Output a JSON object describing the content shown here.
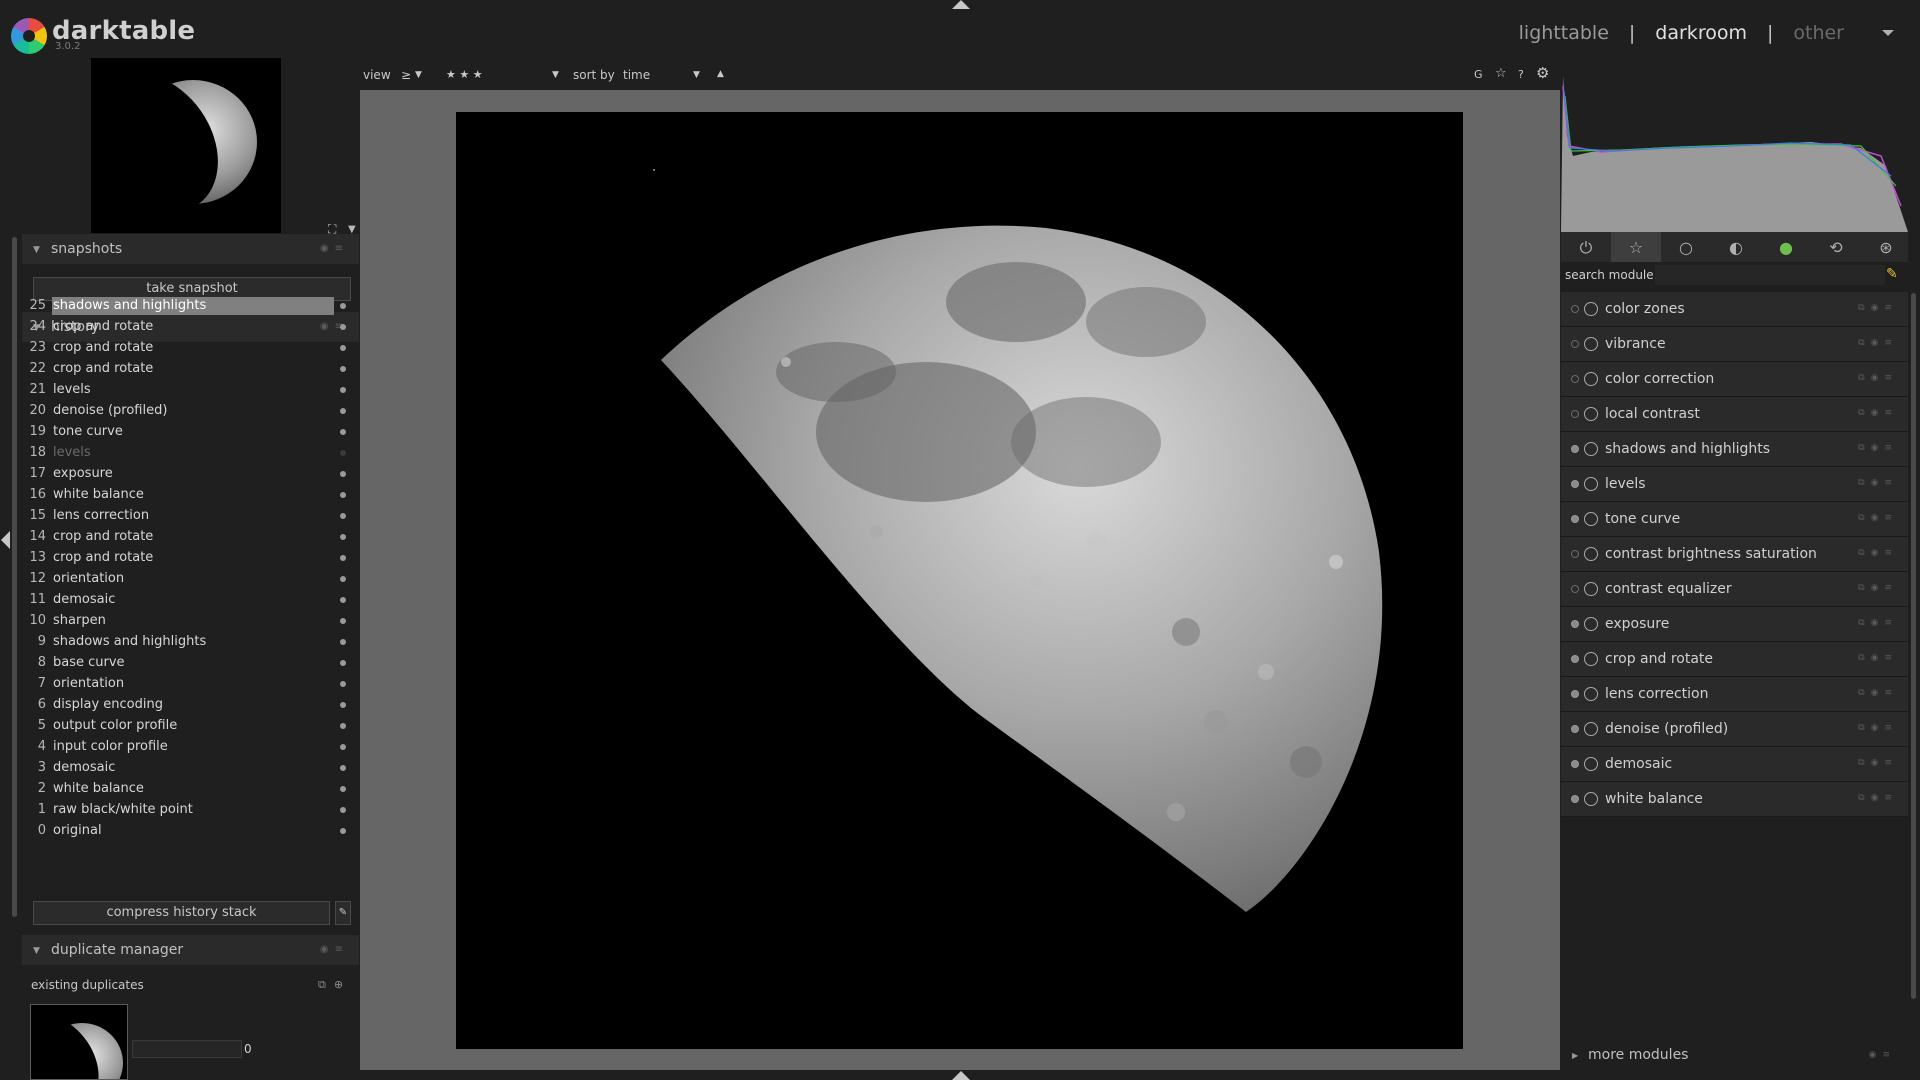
{
  "app": {
    "name": "darktable",
    "version": "3.0.2"
  },
  "views": {
    "lighttable": "lighttable",
    "darkroom": "darkroom",
    "other": "other",
    "separator": "|"
  },
  "filter_bar": {
    "view_label": "view",
    "comparator": "≥",
    "rating": "★ ★ ★",
    "sort_label": "sort by",
    "sort_value": "time",
    "order_arrow": "▲",
    "right_icons": {
      "grouping": "G",
      "star": "☆",
      "help": "?",
      "settings": "⚙"
    }
  },
  "snapshots": {
    "title": "snapshots",
    "take_snapshot": "take snapshot"
  },
  "history": {
    "title": "history",
    "items": [
      {
        "num": "25",
        "name": "shadows and highlights",
        "selected": true
      },
      {
        "num": "24",
        "name": "crop and rotate"
      },
      {
        "num": "23",
        "name": "crop and rotate"
      },
      {
        "num": "22",
        "name": "crop and rotate"
      },
      {
        "num": "21",
        "name": "levels"
      },
      {
        "num": "20",
        "name": "denoise (profiled)"
      },
      {
        "num": "19",
        "name": "tone curve"
      },
      {
        "num": "18",
        "name": "levels",
        "disabled": true
      },
      {
        "num": "17",
        "name": "exposure"
      },
      {
        "num": "16",
        "name": "white balance"
      },
      {
        "num": "15",
        "name": "lens correction"
      },
      {
        "num": "14",
        "name": "crop and rotate"
      },
      {
        "num": "13",
        "name": "crop and rotate"
      },
      {
        "num": "12",
        "name": "orientation"
      },
      {
        "num": "11",
        "name": "demosaic"
      },
      {
        "num": "10",
        "name": "sharpen"
      },
      {
        "num": "9",
        "name": "shadows and highlights"
      },
      {
        "num": "8",
        "name": "base curve"
      },
      {
        "num": "7",
        "name": "orientation"
      },
      {
        "num": "6",
        "name": "display encoding"
      },
      {
        "num": "5",
        "name": "output color profile"
      },
      {
        "num": "4",
        "name": "input color profile"
      },
      {
        "num": "3",
        "name": "demosaic"
      },
      {
        "num": "2",
        "name": "white balance"
      },
      {
        "num": "1",
        "name": "raw black/white point"
      },
      {
        "num": "0",
        "name": "original"
      }
    ],
    "compress_button": "compress history stack"
  },
  "duplicate_manager": {
    "title": "duplicate manager",
    "existing_label": "existing duplicates",
    "count": "0"
  },
  "search": {
    "label": "search module",
    "value": ""
  },
  "modules": [
    {
      "name": "color zones",
      "on": false
    },
    {
      "name": "vibrance",
      "on": false
    },
    {
      "name": "color correction",
      "on": false
    },
    {
      "name": "local contrast",
      "on": false
    },
    {
      "name": "shadows and highlights",
      "on": true
    },
    {
      "name": "levels",
      "on": true
    },
    {
      "name": "tone curve",
      "on": true
    },
    {
      "name": "contrast brightness saturation",
      "on": false
    },
    {
      "name": "contrast equalizer",
      "on": false
    },
    {
      "name": "exposure",
      "on": true
    },
    {
      "name": "crop and rotate",
      "on": true
    },
    {
      "name": "lens correction",
      "on": true
    },
    {
      "name": "denoise (profiled)",
      "on": true
    },
    {
      "name": "demosaic",
      "on": true
    },
    {
      "name": "white balance",
      "on": true
    }
  ],
  "more_modules": "more modules"
}
